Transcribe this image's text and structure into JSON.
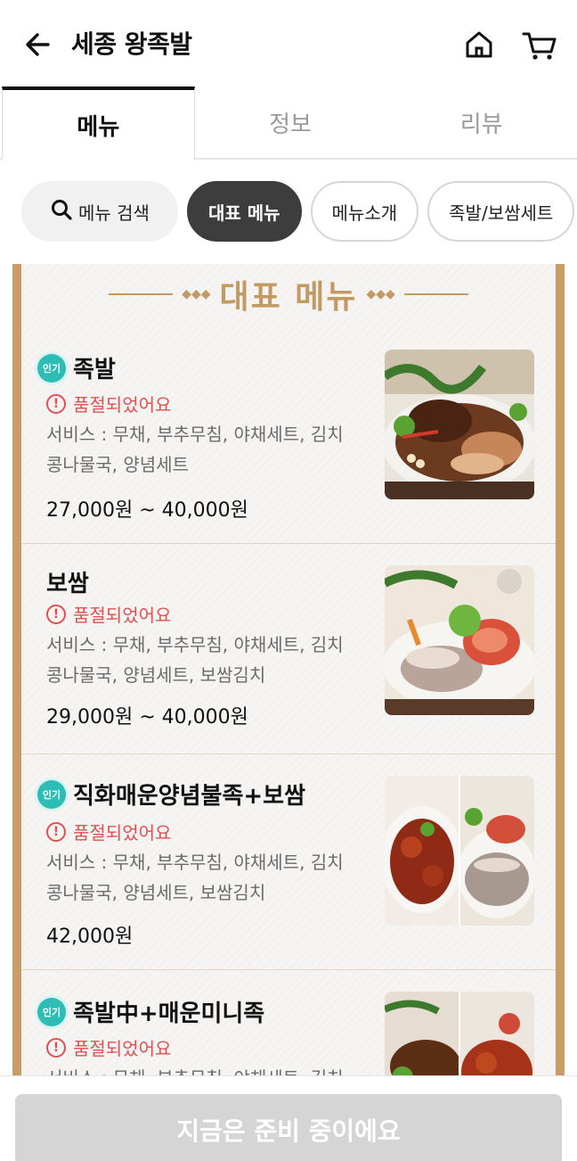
{
  "header": {
    "title": "세종 왕족발"
  },
  "tabs": [
    {
      "label": "메뉴"
    },
    {
      "label": "정보"
    },
    {
      "label": "리뷰"
    }
  ],
  "chips": {
    "search_label": "메뉴 검색",
    "items": [
      {
        "label": "대표 메뉴"
      },
      {
        "label": "메뉴소개"
      },
      {
        "label": "족발/보쌈세트"
      }
    ]
  },
  "board": {
    "title": "대표 메뉴"
  },
  "items": [
    {
      "badge": "인기",
      "name": "족발",
      "status": "품절되었어요",
      "desc_line1": "서비스 : 무채, 부추무침, 야채세트, 김치",
      "desc_line2": "콩나물국, 양념세트",
      "price": "27,000원 ~ 40,000원"
    },
    {
      "badge": "",
      "name": "보쌈",
      "status": "품절되었어요",
      "desc_line1": "서비스 : 무채, 부추무침, 야채세트, 김치",
      "desc_line2": "콩나물국, 양념세트, 보쌈김치",
      "price": "29,000원 ~ 40,000원"
    },
    {
      "badge": "인기",
      "name": "직화매운양념불족+보쌈",
      "status": "품절되었어요",
      "desc_line1": "서비스 : 무채, 부추무침, 야채세트, 김치",
      "desc_line2": "콩나물국, 양념세트, 보쌈김치",
      "price": "42,000원"
    },
    {
      "badge": "인기",
      "name": "족발中+매운미니족",
      "status": "품절되었어요",
      "desc_line1": "서비스 : 무채, 부추무침, 야채세트, 김치",
      "desc_line2": "",
      "price": ""
    }
  ],
  "bottom": {
    "button_label": "지금은 준비 중이에요"
  },
  "colors": {
    "accent_gold": "#c29a62",
    "badge_teal": "#2dbdb4",
    "soldout_red": "#e05050"
  }
}
